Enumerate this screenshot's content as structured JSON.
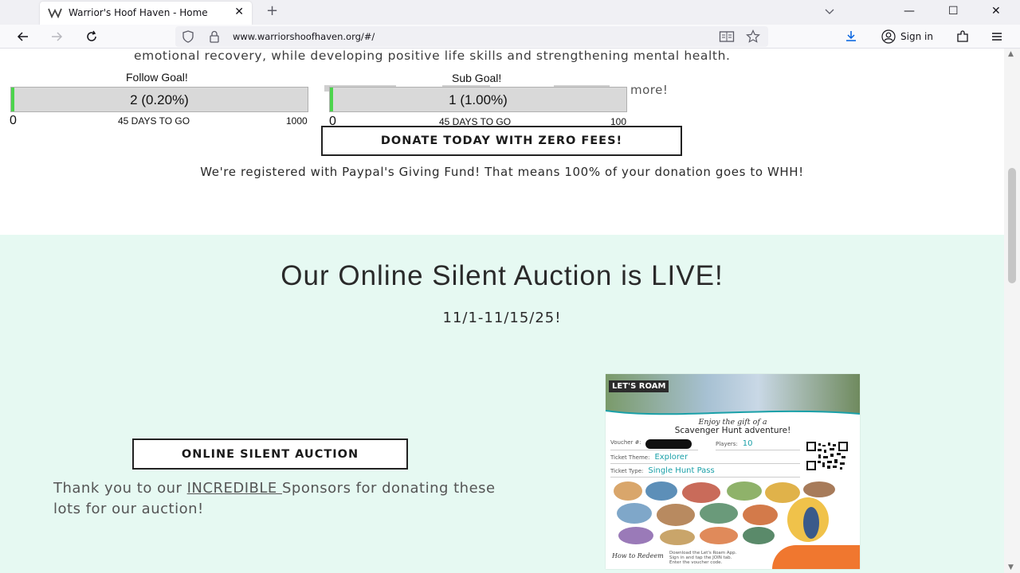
{
  "browser": {
    "tab_title": "Warrior's Hoof Haven - Home",
    "url": "www.warriorshoofhaven.org/#/",
    "signin_label": "Sign in"
  },
  "page": {
    "mission_tail": "emotional recovery, while developing positive life skills and strengthening mental health.",
    "follow_goal": {
      "title": "Follow Goal!",
      "value_text": "2 (0.20%)",
      "progress_fraction": 0.002,
      "min": "0",
      "days": "45 DAYS TO GO",
      "max": "1000"
    },
    "sub_goal": {
      "title": "Sub Goal!",
      "value_text": "1 (1.00%)",
      "progress_fraction": 0.01,
      "min": "0",
      "days": "45 DAYS TO GO",
      "max": "100"
    },
    "more_text": "more!",
    "donate_button": "DONATE TODAY WITH ZERO FEES!",
    "paypal_note": "We're registered with Paypal's Giving Fund! That means 100% of your donation goes to WHH!",
    "auction": {
      "title": "Our Online Silent Auction is LIVE!",
      "dates": "11/1-11/15/25!",
      "button": "ONLINE SILENT AUCTION",
      "thanks_before": "Thank you to our ",
      "thanks_link": "INCREDIBLE ",
      "thanks_after": "Sponsors for donating these lots for our auction!"
    },
    "flyer": {
      "logo": "LET'S ROAM",
      "script_line": "Enjoy the gift of a",
      "headline": "Scavenger Hunt adventure!",
      "voucher_label": "Voucher #:",
      "players_label": "Players:",
      "players_value": "10",
      "theme_label": "Ticket Theme:",
      "theme_value": "Explorer",
      "type_label": "Ticket Type:",
      "type_value": "Single Hunt Pass",
      "howto": "How to Redeem",
      "steps": [
        "Download the Let's Roam App.",
        "Sign in and tap the JOIN tab.",
        "Enter the voucher code."
      ]
    }
  },
  "colors": {
    "auction_bg": "#e6f9f2",
    "progress_fill": "#4cd44c",
    "progress_track": "#d9d9d9",
    "flyer_accent": "#1aa0a8",
    "flyer_orange": "#f0772f"
  }
}
